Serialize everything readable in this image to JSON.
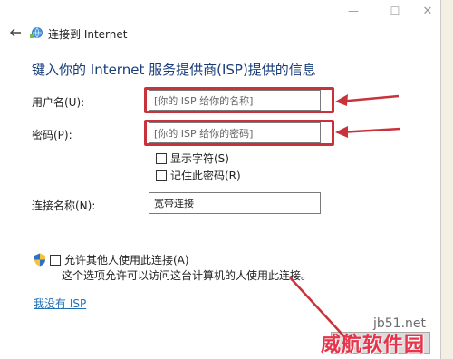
{
  "colors": {
    "accent_heading": "#1a3e7a",
    "annotation_red": "#c8323a",
    "link": "#1d6fb8",
    "watermark_red": "#e8334a"
  },
  "window": {
    "title": "连接到 Internet",
    "controls": {
      "minimize": "—",
      "maximize": "☐",
      "close": "✕"
    }
  },
  "heading": "键入你的 Internet 服务提供商(ISP)提供的信息",
  "fields": {
    "username": {
      "label": "用户名(U):",
      "placeholder": "[你的 ISP 给你的名称]"
    },
    "password": {
      "label": "密码(P):",
      "placeholder": "[你的 ISP 给你的密码]"
    },
    "connection_name": {
      "label": "连接名称(N):",
      "value": "宽带连接"
    }
  },
  "options": {
    "show_chars": "显示字符(S)",
    "remember_password": "记住此密码(R)"
  },
  "allow_others": {
    "label": "允许其他人使用此连接(A)",
    "description": "这个选项允许可以访问这台计算机的人使用此连接。"
  },
  "no_isp_link": "我没有 ISP",
  "watermark": {
    "site": "jb51.net",
    "brand": "威航软件园"
  }
}
